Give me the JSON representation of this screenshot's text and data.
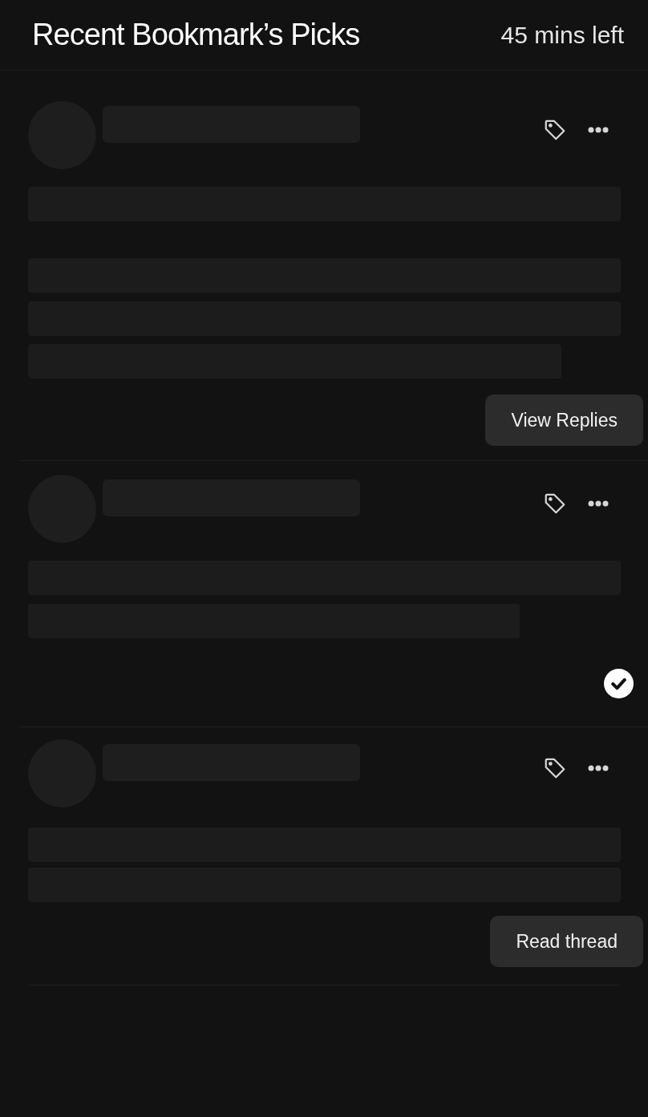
{
  "header": {
    "title": "Recent Bookmark’s Picks",
    "time_left": "45 mins left"
  },
  "posts": [
    {
      "action": {
        "kind": "button",
        "label": "View Replies"
      }
    },
    {
      "action": {
        "kind": "check"
      }
    },
    {
      "action": {
        "kind": "button",
        "label": "Read thread"
      }
    }
  ]
}
